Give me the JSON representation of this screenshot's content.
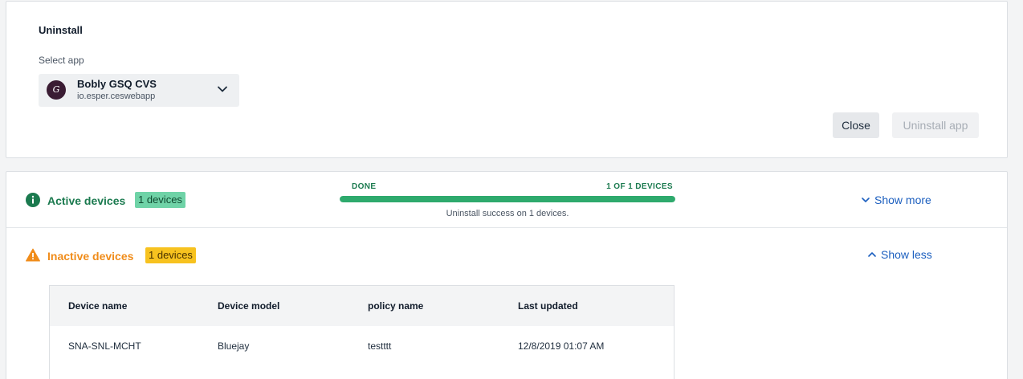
{
  "uninstall": {
    "title": "Uninstall",
    "select_label": "Select app",
    "selected_app": {
      "name": "Bobly GSQ CVS",
      "package": "io.esper.ceswebapp",
      "avatar_glyph": "G"
    },
    "close_label": "Close",
    "uninstall_label": "Uninstall app"
  },
  "active": {
    "label": "Active devices",
    "badge": "1 devices",
    "status": "DONE",
    "count": "1 OF 1 DEVICES",
    "progress_fraction": 1.0,
    "message": "Uninstall success on 1 devices.",
    "toggle": "Show more"
  },
  "inactive": {
    "label": "Inactive devices",
    "badge": "1 devices",
    "toggle": "Show less",
    "table": {
      "headers": [
        "Device name",
        "Device model",
        "policy name",
        "Last updated"
      ],
      "rows": [
        [
          "SNA-SNL-MCHT",
          "Bluejay",
          "testttt",
          "12/8/2019 01:07 AM"
        ]
      ]
    }
  },
  "colors": {
    "success": "#1b7a4f",
    "success_badge": "#6fd3a7",
    "progress": "#2eaa6d",
    "warning": "#f08c1a",
    "warning_badge": "#f7c21f",
    "link": "#1c5fbf"
  },
  "icons": {
    "app_select_chevron": "chevron-down-icon",
    "active_status": "info-icon",
    "inactive_status": "warning-icon",
    "show_more": "chevron-down-icon",
    "show_less": "chevron-up-icon"
  }
}
